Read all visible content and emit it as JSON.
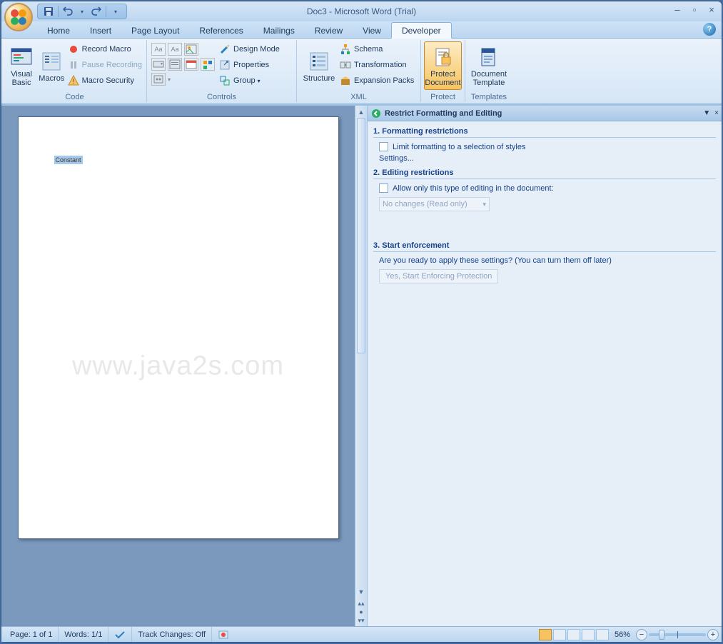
{
  "title": "Doc3 - Microsoft Word (Trial)",
  "tabs": [
    "Home",
    "Insert",
    "Page Layout",
    "References",
    "Mailings",
    "Review",
    "View",
    "Developer"
  ],
  "active_tab": "Developer",
  "ribbon": {
    "code": {
      "label": "Code",
      "visual_basic": "Visual\nBasic",
      "macros": "Macros",
      "record": "Record Macro",
      "pause": "Pause Recording",
      "security": "Macro Security"
    },
    "controls": {
      "label": "Controls",
      "design": "Design Mode",
      "properties": "Properties",
      "group": "Group"
    },
    "xml": {
      "label": "XML",
      "structure": "Structure",
      "schema": "Schema",
      "transformation": "Transformation",
      "packs": "Expansion Packs"
    },
    "protect": {
      "label": "Protect",
      "protect_doc": "Protect\nDocument"
    },
    "templates": {
      "label": "Templates",
      "doc_template": "Document\nTemplate"
    }
  },
  "doc_text": "Constant",
  "taskpane": {
    "title": "Restrict Formatting and Editing",
    "s1": "1. Formatting restrictions",
    "s1_chk": "Limit formatting to a selection of styles",
    "settings": "Settings...",
    "s2": "2. Editing restrictions",
    "s2_chk": "Allow only this type of editing in the document:",
    "s2_sel": "No changes (Read only)",
    "s3": "3. Start enforcement",
    "s3_q": "Are you ready to apply these settings? (You can turn them off later)",
    "s3_btn": "Yes, Start Enforcing Protection"
  },
  "status": {
    "page": "Page: 1 of 1",
    "words": "Words: 1/1",
    "track": "Track Changes: Off",
    "zoom": "56%"
  },
  "watermark": "www.java2s.com"
}
